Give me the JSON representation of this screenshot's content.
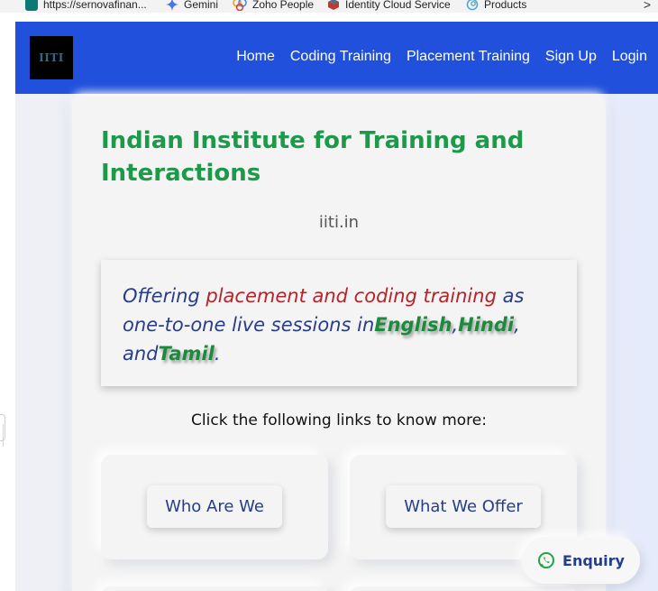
{
  "bookmarks": {
    "items": [
      {
        "label": "https://sernovafinan...",
        "icon": "sharepoint-icon",
        "color": "#0b7a75"
      },
      {
        "label": "Gemini",
        "icon": "gemini-sparkle-icon",
        "color": "#4a74e0"
      },
      {
        "label": "Zoho People",
        "icon": "zoho-people-icon",
        "color": "#e0a52c"
      },
      {
        "label": "Identity Cloud Service",
        "icon": "oracle-cube-icon",
        "color": "#c0392b"
      },
      {
        "label": "Products",
        "icon": "products-swirl-icon",
        "color": "#5aa7c8"
      }
    ],
    "overflow": ">"
  },
  "site": {
    "logo_text": "IITI",
    "nav": [
      "Home",
      "Coding Training",
      "Placement Training",
      "Sign Up",
      "Login"
    ],
    "colors": {
      "nav_bg": "#2150dc",
      "title": "#1c9a4a",
      "accent_red": "#b8232a",
      "accent_blue": "#283c8c"
    }
  },
  "hero": {
    "title": "Indian Institute for Training and Interactions",
    "domain": "iiti.in"
  },
  "offer": {
    "part1": "Offering ",
    "highlight": "placement and coding training",
    "part2": " as one-to-one live sessions in",
    "lang1": "English",
    "sep1": ",",
    "lang2": "Hindi",
    "sep2": ", and",
    "lang3": "Tamil",
    "end": "."
  },
  "links": {
    "label": "Click the following links to know more:",
    "tiles": [
      "Who Are We",
      "What We Offer"
    ]
  },
  "enquiry": {
    "label": "Enquiry",
    "icon": "whatsapp-icon",
    "color": "#25a244"
  }
}
